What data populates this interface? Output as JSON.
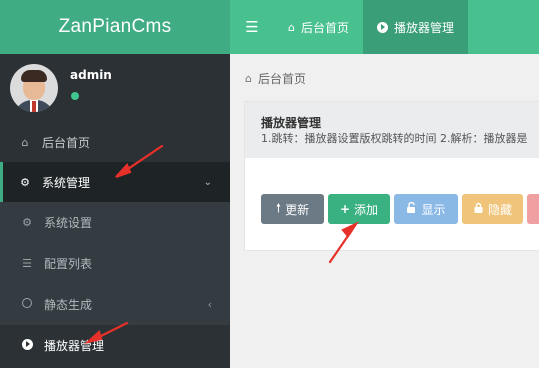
{
  "header": {
    "logo": "ZanPianCms",
    "menu_icon": "bars-icon",
    "tabs": [
      {
        "label": "后台首页",
        "icon": "home-icon"
      },
      {
        "label": "播放器管理",
        "icon": "play-circle-icon"
      }
    ]
  },
  "sidebar": {
    "user": {
      "name": "admin",
      "status_color": "#3fc58f"
    },
    "items": [
      {
        "label": "后台首页",
        "icon": "home-icon"
      },
      {
        "label": "系统管理",
        "icon": "gears-icon"
      },
      {
        "label": "系统设置",
        "icon": "gear-icon"
      },
      {
        "label": "配置列表",
        "icon": "list-icon"
      },
      {
        "label": "静态生成",
        "icon": "circle-icon"
      },
      {
        "label": "播放器管理",
        "icon": "play-circle-icon"
      }
    ]
  },
  "breadcrumb": {
    "label": "后台首页",
    "icon": "home-icon"
  },
  "panel": {
    "title": "播放器管理",
    "description": "1.跳转：播放器设置版权跳转的时间 2.解析：播放器是"
  },
  "toolbar": {
    "refresh_label": "更新",
    "add_label": "添加",
    "show_label": "显示",
    "hide_label": "隐藏"
  },
  "colors": {
    "brand": "#3fac84",
    "topbar": "#48c18f",
    "sidebar": "#2b3135",
    "annotation_arrow": "#e8302a"
  }
}
